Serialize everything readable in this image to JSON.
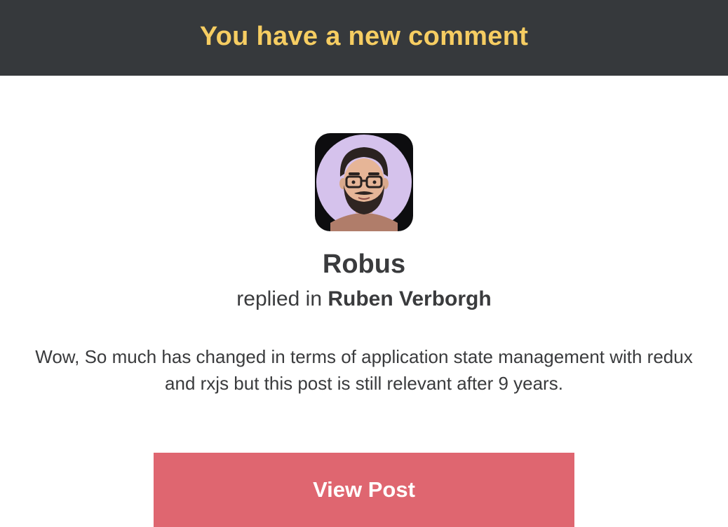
{
  "header": {
    "title": "You have a new comment"
  },
  "comment": {
    "author": "Robus",
    "action_prefix": "replied in",
    "target": "Ruben Verborgh",
    "body": "Wow, So much has changed in terms of application state management with redux and rxjs but this post is still relevant after 9 years."
  },
  "actions": {
    "view_post_label": "View Post"
  },
  "colors": {
    "header_bg": "#36393c",
    "header_text": "#f6cd62",
    "button_bg": "#df6670",
    "body_text": "#3a3b3d"
  }
}
